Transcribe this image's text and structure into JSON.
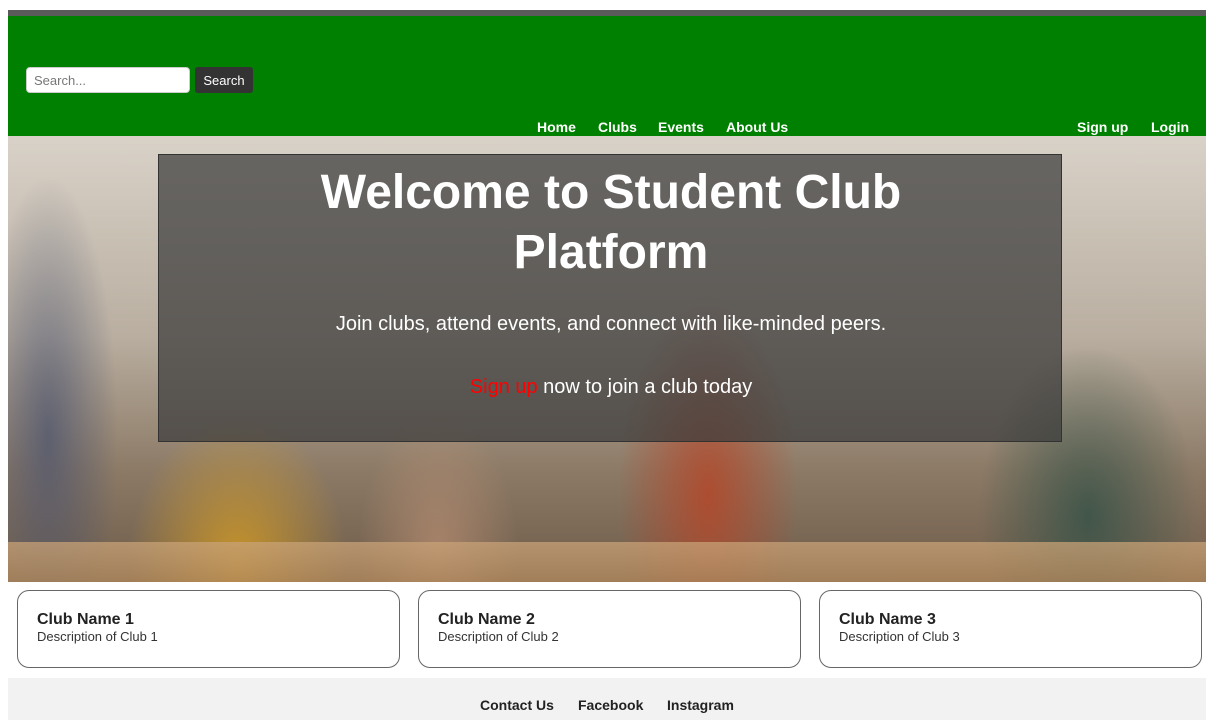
{
  "header": {
    "search": {
      "placeholder": "Search...",
      "value": "",
      "button_label": "Search"
    },
    "nav": {
      "home": "Home",
      "clubs": "Clubs",
      "events": "Events",
      "about": "About Us"
    },
    "auth": {
      "signup": "Sign up",
      "login": "Login"
    },
    "colors": {
      "background": "#008000",
      "link": "#ffffff"
    }
  },
  "hero": {
    "title": "Welcome to Student Club Platform",
    "subtitle": "Join clubs, attend events, and connect with like-minded peers.",
    "cta_link": "Sign up",
    "cta_rest": " now to join a club today",
    "colors": {
      "cta_link": "#ff0000",
      "overlay": "rgba(60,60,60,0.72)"
    }
  },
  "clubs": [
    {
      "name": "Club Name 1",
      "description": "Description of Club 1"
    },
    {
      "name": "Club Name 2",
      "description": "Description of Club 2"
    },
    {
      "name": "Club Name 3",
      "description": "Description of Club 3"
    }
  ],
  "footer": {
    "contact": "Contact Us",
    "facebook": "Facebook",
    "instagram": "Instagram"
  }
}
